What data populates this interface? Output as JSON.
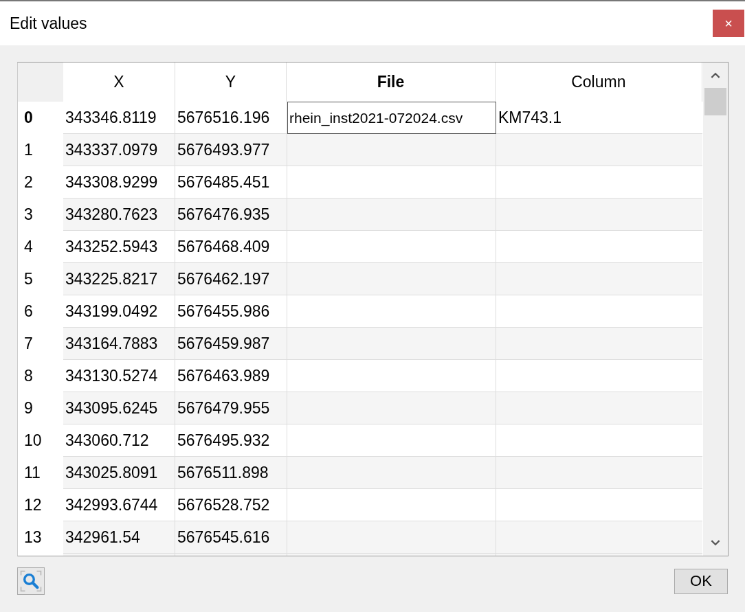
{
  "window": {
    "title": "Edit values",
    "close_label": "×"
  },
  "table": {
    "columns": [
      {
        "label": "X",
        "selected": false
      },
      {
        "label": "Y",
        "selected": false
      },
      {
        "label": "File",
        "selected": true
      },
      {
        "label": "Column",
        "selected": false
      }
    ],
    "rows": [
      {
        "header": "0",
        "selected": true,
        "cells": [
          {
            "text": "343346.8119",
            "editing": false
          },
          {
            "text": "5676516.196",
            "editing": false
          },
          {
            "text": "rhein_inst2021-072024.csv",
            "editing": true
          },
          {
            "text": "KM743.1",
            "editing": false
          }
        ]
      },
      {
        "header": "1",
        "selected": false,
        "cells": [
          {
            "text": "343337.0979",
            "editing": false
          },
          {
            "text": "5676493.977",
            "editing": false
          },
          {
            "editing": false
          },
          {
            "editing": false
          }
        ]
      },
      {
        "header": "2",
        "selected": false,
        "cells": [
          {
            "text": "343308.9299",
            "editing": false
          },
          {
            "text": "5676485.451",
            "editing": false
          },
          {
            "editing": false
          },
          {
            "editing": false
          }
        ]
      },
      {
        "header": "3",
        "selected": false,
        "cells": [
          {
            "text": "343280.7623",
            "editing": false
          },
          {
            "text": "5676476.935",
            "editing": false
          },
          {
            "editing": false
          },
          {
            "editing": false
          }
        ]
      },
      {
        "header": "4",
        "selected": false,
        "cells": [
          {
            "text": "343252.5943",
            "editing": false
          },
          {
            "text": "5676468.409",
            "editing": false
          },
          {
            "editing": false
          },
          {
            "editing": false
          }
        ]
      },
      {
        "header": "5",
        "selected": false,
        "cells": [
          {
            "text": "343225.8217",
            "editing": false
          },
          {
            "text": "5676462.197",
            "editing": false
          },
          {
            "editing": false
          },
          {
            "editing": false
          }
        ]
      },
      {
        "header": "6",
        "selected": false,
        "cells": [
          {
            "text": "343199.0492",
            "editing": false
          },
          {
            "text": "5676455.986",
            "editing": false
          },
          {
            "editing": false
          },
          {
            "editing": false
          }
        ]
      },
      {
        "header": "7",
        "selected": false,
        "cells": [
          {
            "text": "343164.7883",
            "editing": false
          },
          {
            "text": "5676459.987",
            "editing": false
          },
          {
            "editing": false
          },
          {
            "editing": false
          }
        ]
      },
      {
        "header": "8",
        "selected": false,
        "cells": [
          {
            "text": "343130.5274",
            "editing": false
          },
          {
            "text": "5676463.989",
            "editing": false
          },
          {
            "editing": false
          },
          {
            "editing": false
          }
        ]
      },
      {
        "header": "9",
        "selected": false,
        "cells": [
          {
            "text": "343095.6245",
            "editing": false
          },
          {
            "text": "5676479.955",
            "editing": false
          },
          {
            "editing": false
          },
          {
            "editing": false
          }
        ]
      },
      {
        "header": "10",
        "selected": false,
        "cells": [
          {
            "text": "343060.712",
            "editing": false
          },
          {
            "text": "5676495.932",
            "editing": false
          },
          {
            "editing": false
          },
          {
            "editing": false
          }
        ]
      },
      {
        "header": "11",
        "selected": false,
        "cells": [
          {
            "text": "343025.8091",
            "editing": false
          },
          {
            "text": "5676511.898",
            "editing": false
          },
          {
            "editing": false
          },
          {
            "editing": false
          }
        ]
      },
      {
        "header": "12",
        "selected": false,
        "cells": [
          {
            "text": "342993.6744",
            "editing": false
          },
          {
            "text": "5676528.752",
            "editing": false
          },
          {
            "editing": false
          },
          {
            "editing": false
          }
        ]
      },
      {
        "header": "13",
        "selected": false,
        "cells": [
          {
            "text": "342961.54",
            "editing": false
          },
          {
            "text": "5676545.616",
            "editing": false
          },
          {
            "editing": false
          },
          {
            "editing": false
          }
        ]
      }
    ]
  },
  "buttons": [
    {
      "label": "OK"
    }
  ]
}
